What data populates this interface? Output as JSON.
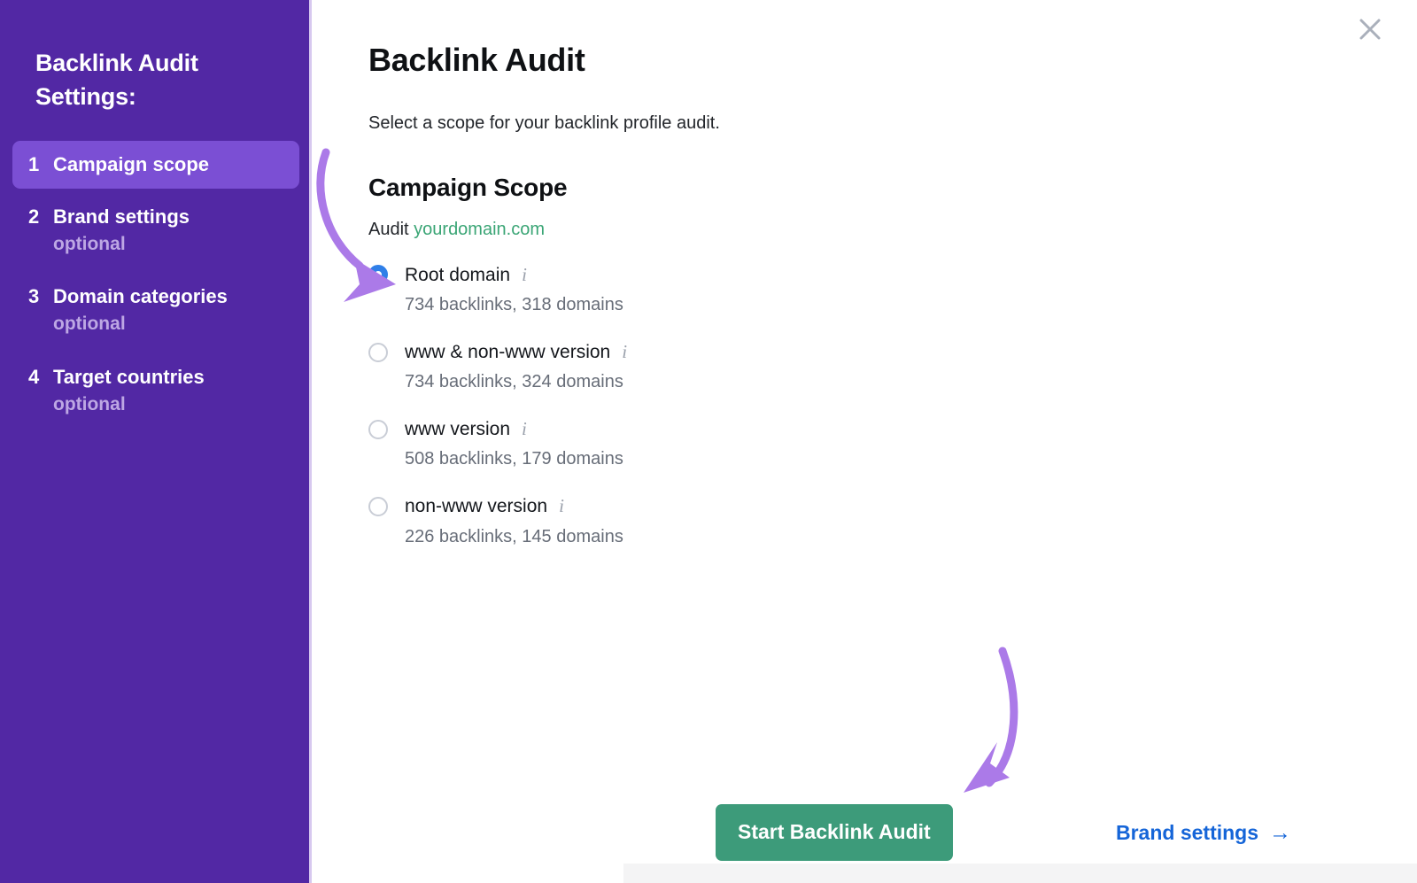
{
  "sidebar": {
    "title": "Backlink Audit\nSettings:",
    "steps": [
      {
        "num": "1",
        "label": "Campaign scope",
        "optional": "",
        "active": true
      },
      {
        "num": "2",
        "label": "Brand settings",
        "optional": "optional",
        "active": false
      },
      {
        "num": "3",
        "label": "Domain categories",
        "optional": "optional",
        "active": false
      },
      {
        "num": "4",
        "label": "Target countries",
        "optional": "optional",
        "active": false
      }
    ],
    "background_color": "#5228a4",
    "active_color": "#7b4fd4"
  },
  "main": {
    "close_icon": "close-icon",
    "page_title": "Backlink Audit",
    "subtitle": "Select a scope for your backlink profile audit.",
    "section_title": "Campaign Scope",
    "audit_prefix": "Audit",
    "audit_domain": "yourdomain.com",
    "audit_domain_color": "#3aa575",
    "options": [
      {
        "label": "Root domain",
        "info_icon": "info-icon",
        "selected": true,
        "stats": "734 backlinks, 318 domains"
      },
      {
        "label": "www & non-www version",
        "info_icon": "info-icon",
        "selected": false,
        "stats": "734 backlinks, 324 domains"
      },
      {
        "label": "www version",
        "info_icon": "info-icon",
        "selected": false,
        "stats": "508 backlinks, 179 domains"
      },
      {
        "label": "non-www version",
        "info_icon": "info-icon",
        "selected": false,
        "stats": "226 backlinks, 145 domains"
      }
    ]
  },
  "footer": {
    "start_button": "Start Backlink Audit",
    "start_button_color": "#3d9b7a",
    "brand_link": "Brand settings",
    "brand_link_arrow": "→",
    "brand_link_color": "#1565d8"
  },
  "annotations": {
    "arrow_color": "#ab7ae8",
    "arrow_1_target": "root-domain-radio",
    "arrow_2_target": "start-backlink-audit-button"
  }
}
